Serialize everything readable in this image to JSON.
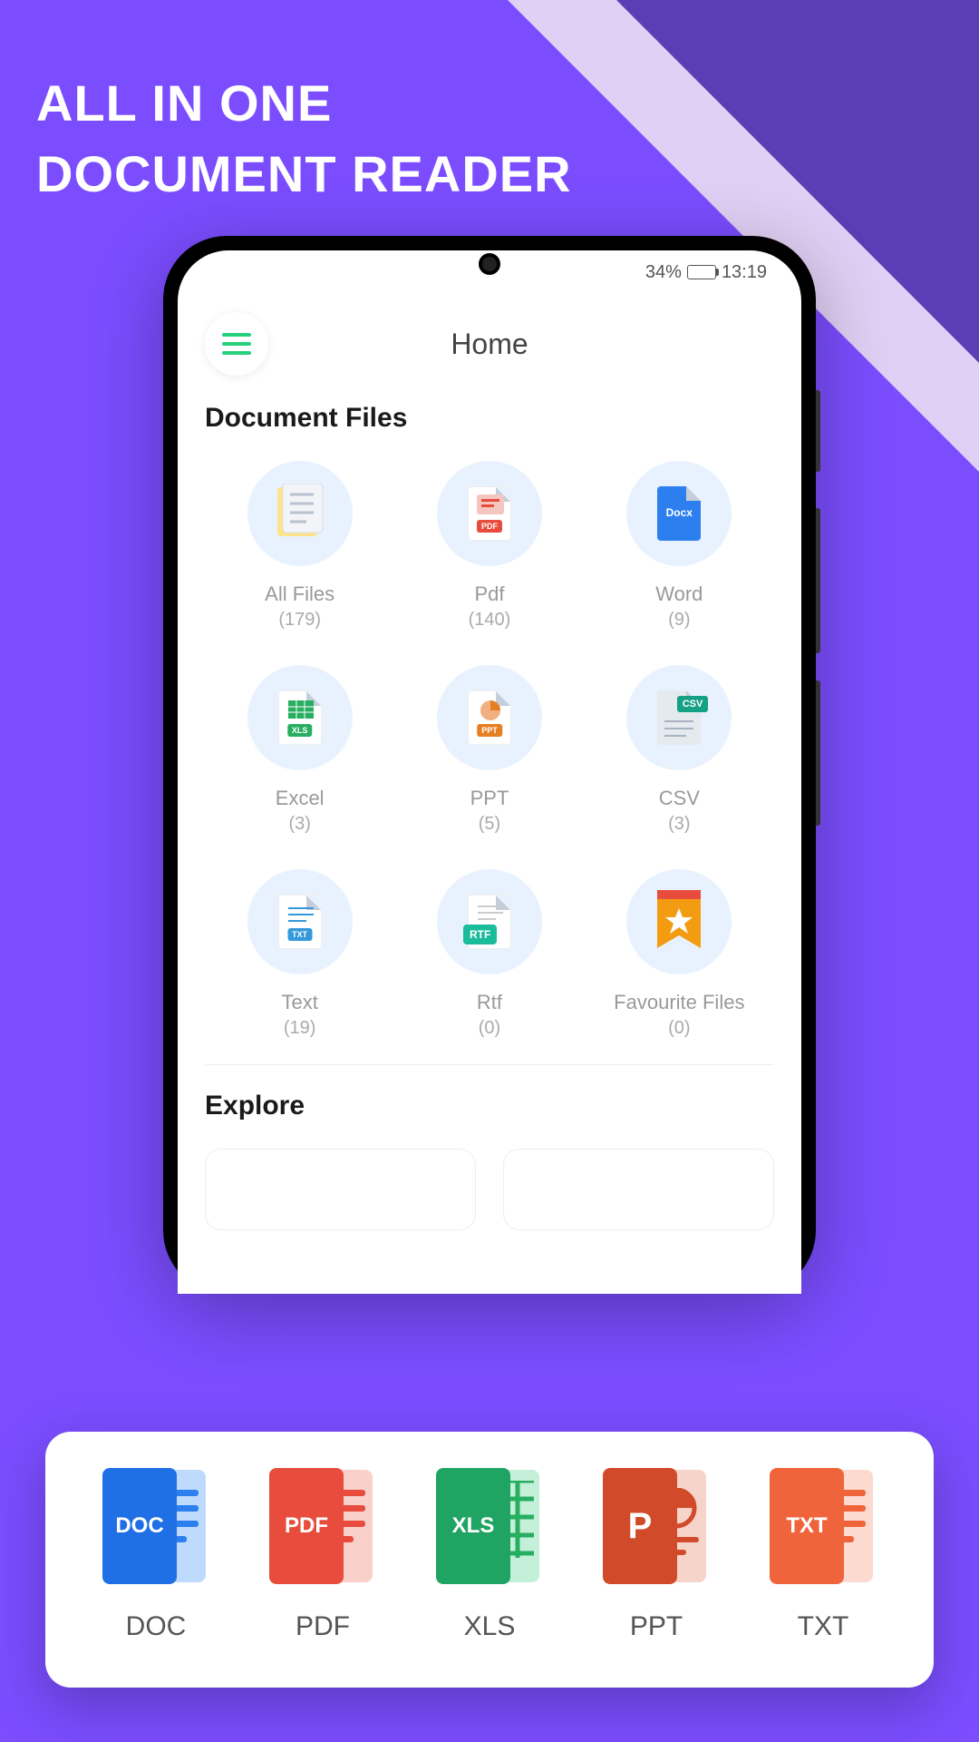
{
  "promo": {
    "title_line1": "ALL IN ONE",
    "title_line2": "DOCUMENT READER"
  },
  "status_bar": {
    "battery_percent": "34%",
    "time": "13:19"
  },
  "header": {
    "title": "Home"
  },
  "sections": {
    "document_files": "Document Files",
    "explore": "Explore"
  },
  "doc_types": [
    {
      "label": "All Files",
      "count": "(179)",
      "icon": "all-files",
      "bg": "#fff",
      "tag": "",
      "tag_bg": ""
    },
    {
      "label": "Pdf",
      "count": "(140)",
      "icon": "pdf",
      "bg": "#fff",
      "tag": "PDF",
      "tag_bg": "#E74C3C"
    },
    {
      "label": "Word",
      "count": "(9)",
      "icon": "docx",
      "bg": "#2D7FF0",
      "tag": "Docx",
      "tag_bg": "#2D7FF0"
    },
    {
      "label": "Excel",
      "count": "(3)",
      "icon": "xls",
      "bg": "#fff",
      "tag": "XLS",
      "tag_bg": "#27AE60"
    },
    {
      "label": "PPT",
      "count": "(5)",
      "icon": "ppt",
      "bg": "#fff",
      "tag": "PPT",
      "tag_bg": "#E67E22"
    },
    {
      "label": "CSV",
      "count": "(3)",
      "icon": "csv",
      "bg": "#fff",
      "tag": "CSV",
      "tag_bg": "#16A085"
    },
    {
      "label": "Text",
      "count": "(19)",
      "icon": "txt",
      "bg": "#fff",
      "tag": "TXT",
      "tag_bg": "#3498DB"
    },
    {
      "label": "Rtf",
      "count": "(0)",
      "icon": "rtf",
      "bg": "#fff",
      "tag": "RTF",
      "tag_bg": "#1ABC9C"
    },
    {
      "label": "Favourite Files",
      "count": "(0)",
      "icon": "favourite",
      "bg": "",
      "tag": "",
      "tag_bg": ""
    }
  ],
  "formats": [
    {
      "label": "DOC",
      "tag": "DOC",
      "front": "#1F6FE5",
      "back": "#BEDAFC",
      "line": "#2D7FF0"
    },
    {
      "label": "PDF",
      "tag": "PDF",
      "front": "#E74C3C",
      "back": "#FAD0CB",
      "line": "#E74C3C"
    },
    {
      "label": "XLS",
      "tag": "XLS",
      "front": "#1FA463",
      "back": "#C4EFD9",
      "line": "#27AE60"
    },
    {
      "label": "PPT",
      "tag": "P",
      "front": "#D14A2A",
      "back": "#F7D4C9",
      "line": "#D14A2A"
    },
    {
      "label": "TXT",
      "tag": "TXT",
      "front": "#F0643C",
      "back": "#FCDACF",
      "line": "#F0643C"
    }
  ]
}
